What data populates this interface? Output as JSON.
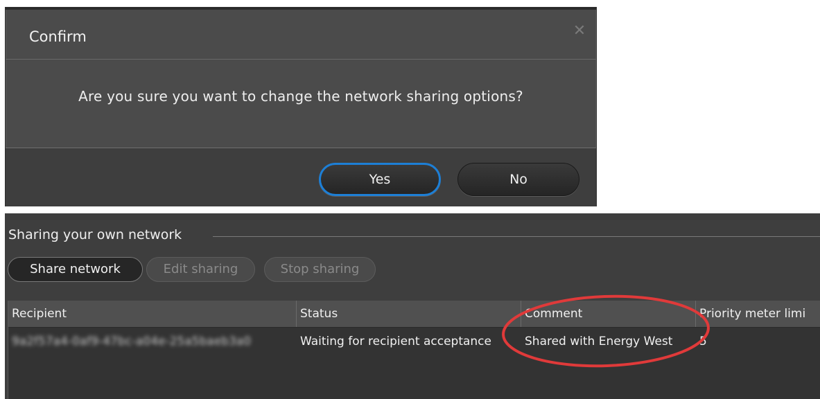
{
  "dialog": {
    "title": "Confirm",
    "close_glyph": "✕",
    "message": "Are you sure you want to change the network sharing options?",
    "yes_label": "Yes",
    "no_label": "No"
  },
  "panel": {
    "header": "Sharing your own network",
    "buttons": {
      "share": "Share network",
      "edit": "Edit sharing",
      "stop": "Stop sharing"
    },
    "table": {
      "columns": [
        "Recipient",
        "Status",
        "Comment",
        "Priority meter limi"
      ],
      "rows": [
        {
          "recipient": "9a2f57a4-0af9-47bc-a04e-25a5baeb3a0",
          "status": "Waiting for recipient acceptance",
          "comment": "Shared with Energy West",
          "priority": "5"
        }
      ]
    }
  },
  "colors": {
    "accent": "#1d7fd6",
    "annotation": "#e03a3a"
  }
}
